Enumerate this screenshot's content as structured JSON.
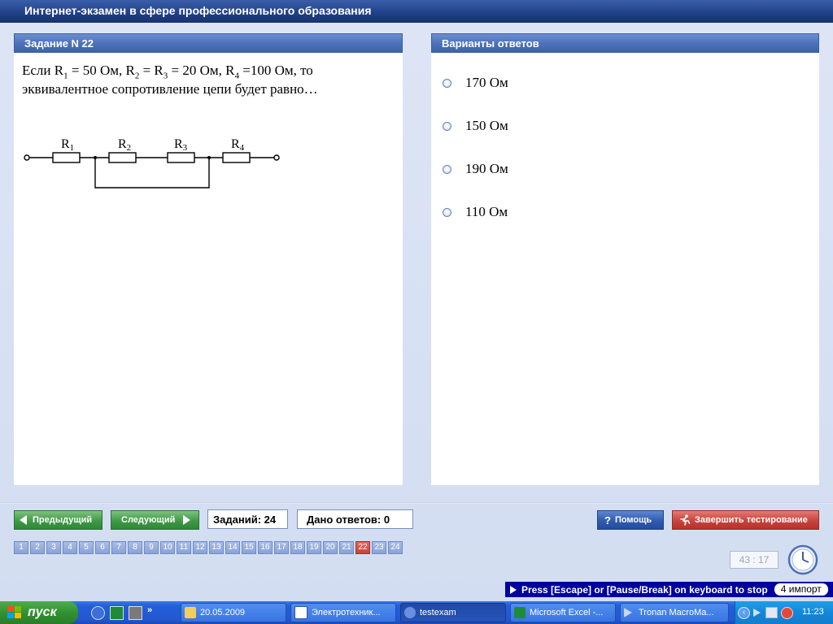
{
  "window": {
    "title": "Интернет-экзамен в сфере профессионального образования"
  },
  "question_panel": {
    "header": "Задание N 22",
    "text_parts": {
      "p1": "Если R",
      "s1": "1",
      "p2": " = 50  Ом, R",
      "s2": "2",
      "p3": " = R",
      "s3": "3",
      "p4": " = 20  Ом, R",
      "s4": "4",
      "p5": " =100  Ом, то эквивалентное сопротивление цепи будет равно…"
    },
    "circuit": {
      "labels": [
        "R",
        "R",
        "R",
        "R"
      ],
      "subscripts": [
        "1",
        "2",
        "3",
        "4"
      ]
    }
  },
  "answers_panel": {
    "header": "Варианты ответов",
    "options": [
      "170 Ом",
      "150 Ом",
      "190 Ом",
      "110 Ом"
    ]
  },
  "nav": {
    "prev_label": "Предыдущий",
    "next_label": "Следующий",
    "tasks_counter": "Заданий: 24",
    "answers_counter": "Дано ответов: 0",
    "help_label": "Помощь",
    "finish_label": "Завершить тестирование",
    "question_numbers": [
      "1",
      "2",
      "3",
      "4",
      "5",
      "6",
      "7",
      "8",
      "9",
      "10",
      "11",
      "12",
      "13",
      "14",
      "15",
      "16",
      "17",
      "18",
      "19",
      "20",
      "21",
      "22",
      "23",
      "24"
    ],
    "current_question": "22",
    "timer": "43 : 17"
  },
  "hint_bar": {
    "text": "Press [Escape] or [Pause/Break] on keyboard to stop",
    "box": "4 импорт"
  },
  "taskbar": {
    "start_label": "пуск",
    "tasks": [
      {
        "label": "20.05.2009",
        "icon": "folder-icon"
      },
      {
        "label": "Электротехник...",
        "icon": "word-icon"
      },
      {
        "label": "testexam",
        "icon": "testexam-icon",
        "active": true
      },
      {
        "label": "Microsoft Excel -...",
        "icon": "excel-icon"
      },
      {
        "label": "Tronan MacroMa...",
        "icon": "macro-icon"
      }
    ],
    "clock": "11:23"
  },
  "colors": {
    "header_blue": "#4b70b8",
    "active_question": "#c9433b",
    "taskbar_blue": "#245edb"
  }
}
